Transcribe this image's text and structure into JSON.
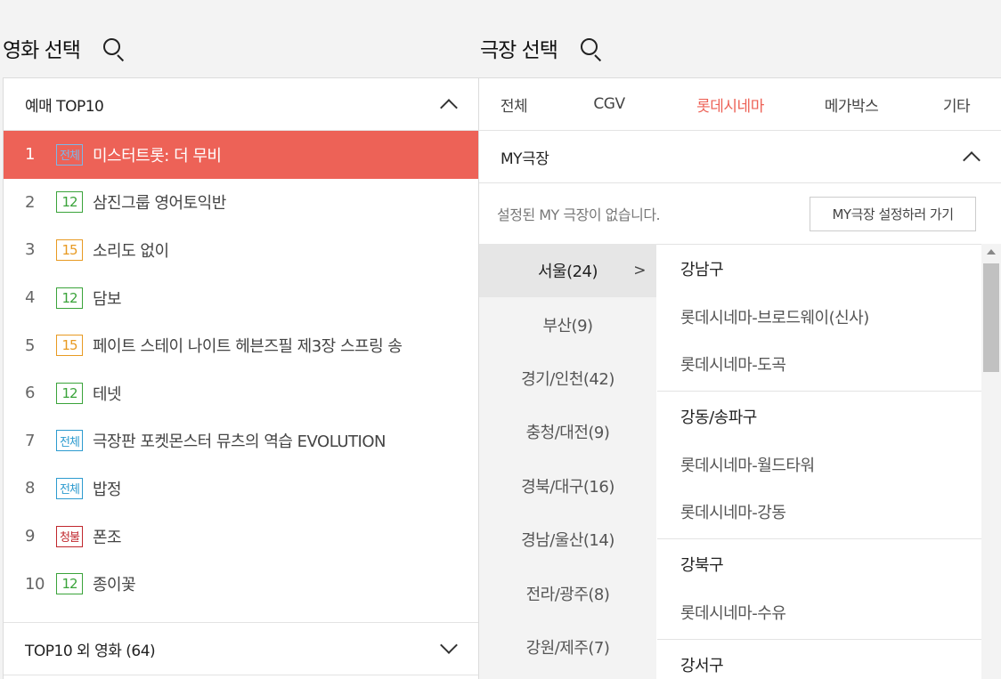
{
  "movie_section": {
    "title": "영화 선택"
  },
  "theater_section": {
    "title": "극장 선택"
  },
  "top10": {
    "header": "예매 TOP10",
    "movies": [
      {
        "rank": "1",
        "rating": "전체",
        "rating_class": "b-all",
        "title": "미스터트롯: 더 무비",
        "active": true
      },
      {
        "rank": "2",
        "rating": "12",
        "rating_class": "b-12",
        "title": "삼진그룹 영어토익반"
      },
      {
        "rank": "3",
        "rating": "15",
        "rating_class": "b-15",
        "title": "소리도 없이"
      },
      {
        "rank": "4",
        "rating": "12",
        "rating_class": "b-12",
        "title": "담보"
      },
      {
        "rank": "5",
        "rating": "15",
        "rating_class": "b-15",
        "title": "페이트 스테이 나이트 헤븐즈필 제3장 스프링 송"
      },
      {
        "rank": "6",
        "rating": "12",
        "rating_class": "b-12",
        "title": "테넷"
      },
      {
        "rank": "7",
        "rating": "전체",
        "rating_class": "b-all",
        "title": "극장판 포켓몬스터 뮤츠의 역습 EVOLUTION"
      },
      {
        "rank": "8",
        "rating": "전체",
        "rating_class": "b-all",
        "title": "밥정"
      },
      {
        "rank": "9",
        "rating": "청불",
        "rating_class": "b-adult",
        "title": "폰조"
      },
      {
        "rank": "10",
        "rating": "12",
        "rating_class": "b-12",
        "title": "종이꽃"
      }
    ]
  },
  "other_movies": {
    "header": "TOP10 외 영화 (64)"
  },
  "tabs": [
    {
      "label": "전체"
    },
    {
      "label": "CGV"
    },
    {
      "label": "롯데시네마",
      "active": true
    },
    {
      "label": "메가박스"
    },
    {
      "label": "기타"
    }
  ],
  "my_theater": {
    "header": "MY극장",
    "message": "설정된 MY 극장이 없습니다.",
    "button": "MY극장 설정하러 가기"
  },
  "regions": [
    {
      "label": "서울(24)",
      "active": true
    },
    {
      "label": "부산(9)"
    },
    {
      "label": "경기/인천(42)"
    },
    {
      "label": "충청/대전(9)"
    },
    {
      "label": "경북/대구(16)"
    },
    {
      "label": "경남/울산(14)"
    },
    {
      "label": "전라/광주(8)"
    },
    {
      "label": "강원/제주(7)"
    }
  ],
  "region_arrow": ">",
  "districts": [
    {
      "name": "강남구",
      "theaters": [
        "롯데시네마-브로드웨이(신사)",
        "롯데시네마-도곡"
      ]
    },
    {
      "name": "강동/송파구",
      "theaters": [
        "롯데시네마-월드타워",
        "롯데시네마-강동"
      ]
    },
    {
      "name": "강북구",
      "theaters": [
        "롯데시네마-수유"
      ]
    },
    {
      "name": "강서구",
      "theaters": []
    }
  ],
  "colors": {
    "accent": "#ed6257"
  }
}
